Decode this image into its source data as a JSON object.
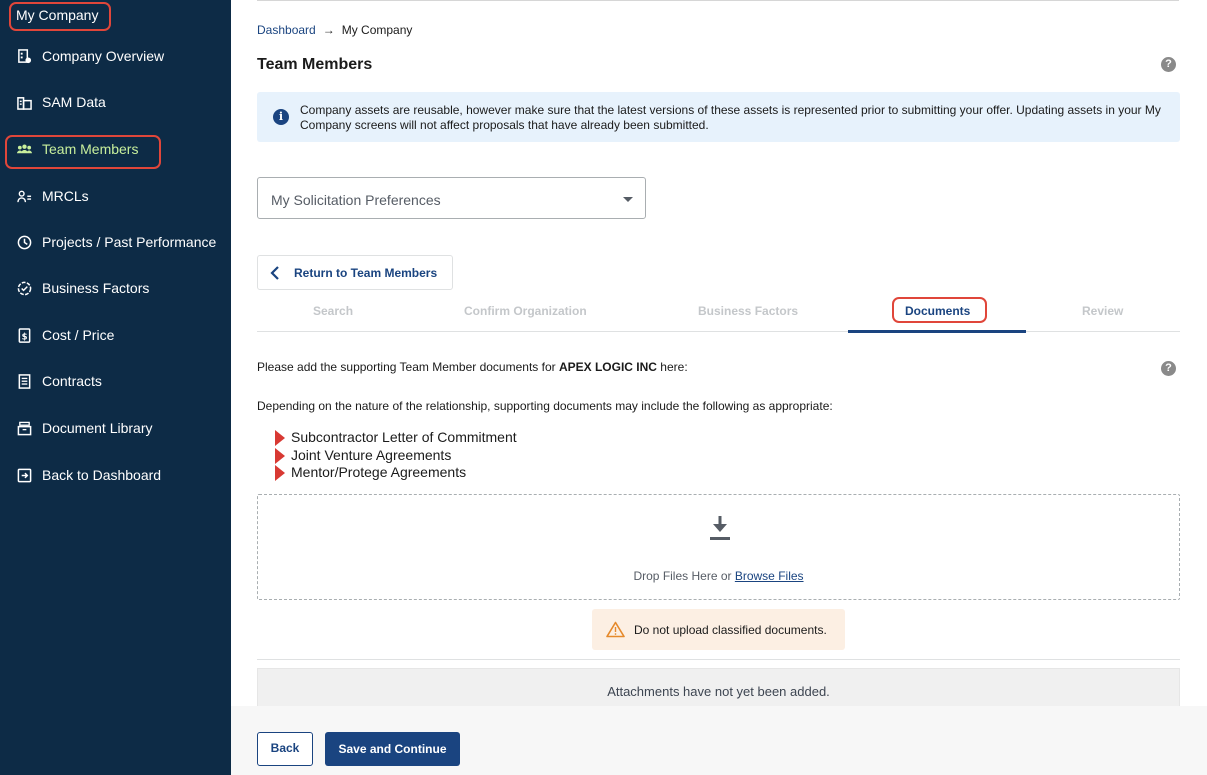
{
  "sidebar": {
    "title": "My Company",
    "items": [
      {
        "label": "Company Overview",
        "icon": "company-overview-icon"
      },
      {
        "label": "SAM Data",
        "icon": "sam-data-icon"
      },
      {
        "label": "Team Members",
        "icon": "team-members-icon",
        "active": true
      },
      {
        "label": "MRCLs",
        "icon": "mrcls-icon"
      },
      {
        "label": "Projects / Past Performance",
        "icon": "projects-icon"
      },
      {
        "label": "Business Factors",
        "icon": "business-factors-icon"
      },
      {
        "label": "Cost / Price",
        "icon": "cost-price-icon"
      },
      {
        "label": "Contracts",
        "icon": "contracts-icon"
      },
      {
        "label": "Document Library",
        "icon": "document-library-icon"
      },
      {
        "label": "Back to Dashboard",
        "icon": "back-to-dashboard-icon"
      }
    ]
  },
  "breadcrumb": {
    "root": "Dashboard",
    "arrow": "→",
    "current": "My Company"
  },
  "page": {
    "title": "Team Members"
  },
  "info_alert": {
    "text": "Company assets are reusable, however make sure that the latest versions of these assets is represented prior to submitting your offer. Updating assets in your My Company screens will not affect proposals that have already been submitted."
  },
  "preferences_select": {
    "value": "My Solicitation Preferences"
  },
  "return_button": {
    "label": "Return to Team Members"
  },
  "steps": [
    {
      "label": "Search"
    },
    {
      "label": "Confirm Organization"
    },
    {
      "label": "Business Factors"
    },
    {
      "label": "Documents",
      "active": true
    },
    {
      "label": "Review"
    }
  ],
  "documents": {
    "intro_prefix": "Please add the supporting Team Member documents for ",
    "company": "APEX LOGIC INC",
    "intro_suffix": " here:",
    "depend_text": "Depending on the nature of the relationship, supporting documents may include the following as appropriate:",
    "list": [
      "Subcontractor Letter of Commitment",
      "Joint Venture Agreements",
      "Mentor/Protege Agreements"
    ],
    "drop_text": "Drop Files Here or ",
    "browse_link": "Browse Files",
    "warning": "Do not upload classified documents.",
    "empty_text": "Attachments have not yet been added."
  },
  "footer": {
    "back_label": "Back",
    "save_label": "Save and Continue"
  },
  "colors": {
    "sidebar_bg": "#0d2b46",
    "primary": "#1a4480",
    "highlight": "#e0463a",
    "active_nav": "#c8ef9c"
  }
}
